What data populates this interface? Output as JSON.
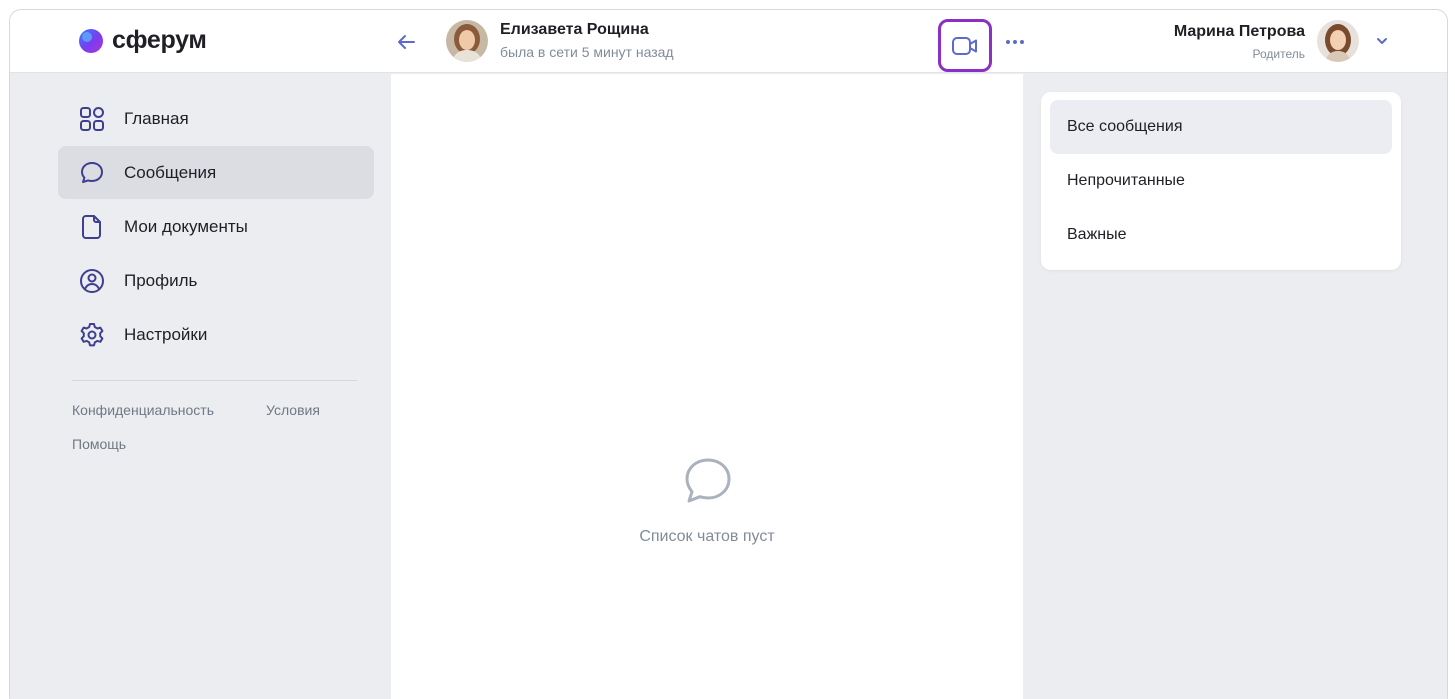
{
  "brand": {
    "name": "сферум"
  },
  "chat": {
    "name": "Елизавета Рощина",
    "status": "была в сети 5 минут назад"
  },
  "user": {
    "name": "Марина Петрова",
    "role": "Родитель"
  },
  "nav": {
    "items": [
      {
        "label": "Главная",
        "icon": "grid-icon"
      },
      {
        "label": "Сообщения",
        "icon": "message-bubble-icon"
      },
      {
        "label": "Мои документы",
        "icon": "document-icon"
      },
      {
        "label": "Профиль",
        "icon": "user-circle-icon"
      },
      {
        "label": "Настройки",
        "icon": "gear-icon"
      }
    ],
    "active": "Сообщения"
  },
  "footer": {
    "privacy": "Конфиденциальность",
    "terms": "Условия",
    "help": "Помощь"
  },
  "empty_state": {
    "text": "Список чатов пуст"
  },
  "filters": {
    "items": [
      {
        "label": "Все сообщения"
      },
      {
        "label": "Непрочитанные"
      },
      {
        "label": "Важные"
      }
    ],
    "active": "Все сообщения"
  },
  "colors": {
    "accent": "#5c6bcb",
    "highlight": "#8c2fc7",
    "icon": "#3f3f8f",
    "muted": "#818c99"
  }
}
